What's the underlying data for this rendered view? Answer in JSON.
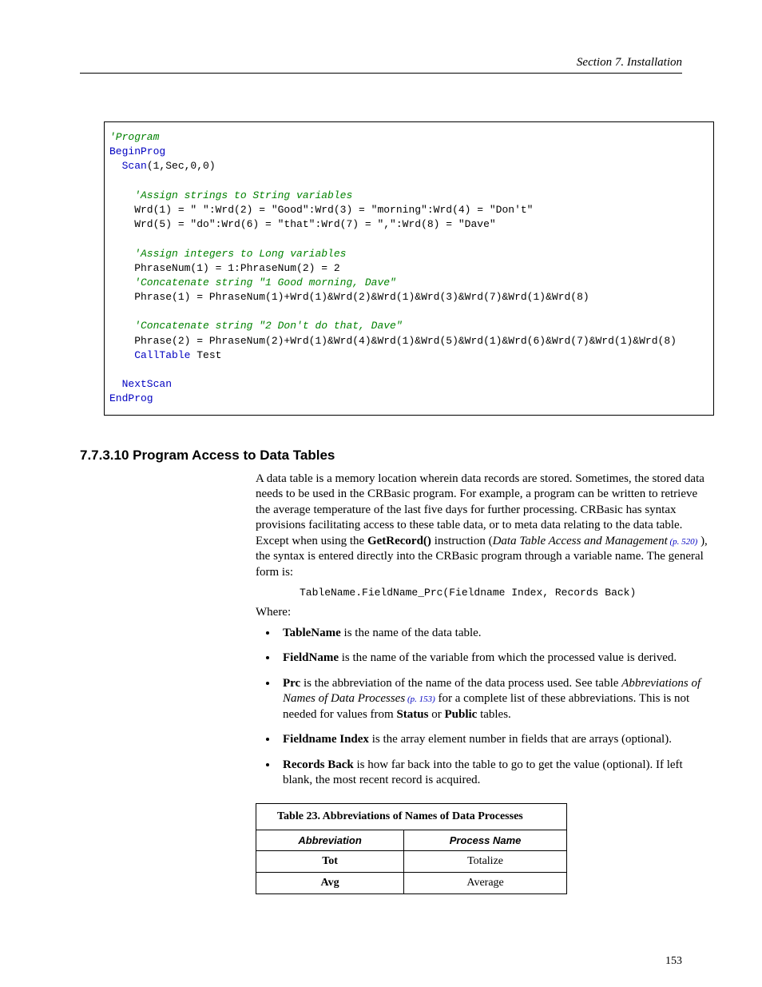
{
  "header": {
    "running": "Section 7.  Installation"
  },
  "code": {
    "c1": "'Program",
    "b1": "BeginProg",
    "b2": "  Scan",
    "p2": "(1,Sec,0,0)",
    "c2": "    'Assign strings to String variables",
    "p3": "    Wrd(1) = \" \":Wrd(2) = \"Good\":Wrd(3) = \"morning\":Wrd(4) = \"Don't\"",
    "p4": "    Wrd(5) = \"do\":Wrd(6) = \"that\":Wrd(7) = \",\":Wrd(8) = \"Dave\"",
    "c3": "    'Assign integers to Long variables",
    "p5": "    PhraseNum(1) = 1:PhraseNum(2) = 2",
    "c4": "    'Concatenate string \"1 Good morning, Dave\"",
    "p6": "    Phrase(1) = PhraseNum(1)+Wrd(1)&Wrd(2)&Wrd(1)&Wrd(3)&Wrd(7)&Wrd(1)&Wrd(8)",
    "c5": "    'Concatenate string \"2 Don't do that, Dave\"",
    "p7": "    Phrase(2) = PhraseNum(2)+Wrd(1)&Wrd(4)&Wrd(1)&Wrd(5)&Wrd(1)&Wrd(6)&Wrd(7)&Wrd(1)&Wrd(8)",
    "b3a": "    CallTable",
    "p8": " Test",
    "b4": "  NextScan",
    "b5": "EndProg"
  },
  "section": {
    "num": "7.7.3.10 Program Access to Data Tables",
    "para1a": "A data table is a memory location wherein data records are stored.  Sometimes, the stored data needs to be used in the CRBasic program.  For example, a program can be written to retrieve the average temperature of the last five days for further processing.  CRBasic has syntax provisions facilitating access to these table data, or to meta data relating to the data table. Except when using the ",
    "getrec": "GetRecord()",
    "para1b": " instruction (",
    "ref1_i": "Data Table Access and Management",
    "ref1_p": " (p. 520)",
    "para1c": " ), the syntax is entered directly into the CRBasic program through a variable name. The general form is:",
    "syntax": "TableName.FieldName_Prc(Fieldname Index, Records Back)",
    "where": "Where:",
    "li1a": "TableName",
    "li1b": " is the name of the data table.",
    "li2a": "FieldName",
    "li2b": " is the name of the variable from which the processed value is derived.",
    "li3a": "Prc",
    "li3b": " is the abbreviation of the name of the data process used. See table ",
    "li3c": "Abbreviations of Names of Data Processes",
    "li3d": " (p. 153)",
    "li3e": " for a complete list of these abbreviations. This is not needed for values from ",
    "li3f": "Status",
    "li3g": " or ",
    "li3h": "Public",
    "li3i": " tables.",
    "li4a": "Fieldname Index",
    "li4b": " is the array element number in fields that are arrays (optional).",
    "li5a": "Records Back",
    "li5b": " is how far back into the table to go to get the value (optional). If left blank, the most recent record is acquired."
  },
  "table": {
    "title": "Table 23. Abbreviations of Names of Data Processes",
    "h1": "Abbreviation",
    "h2": "Process Name",
    "rows": [
      {
        "a": "Tot",
        "b": "Totalize"
      },
      {
        "a": "Avg",
        "b": "Average"
      }
    ]
  },
  "page_number": "153"
}
